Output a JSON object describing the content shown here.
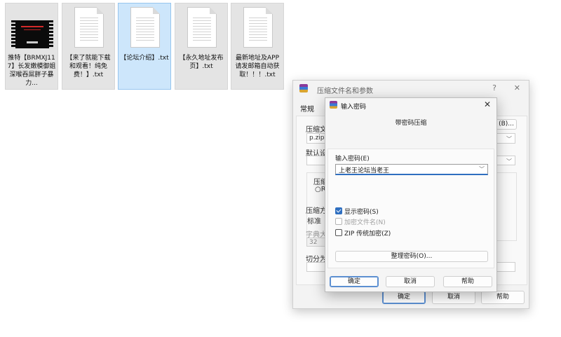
{
  "desktop": {
    "files": [
      {
        "name": "推特【BRMXJ117】长发嫩模御姐深喉吞屌胖子暴力..."
      },
      {
        "name": "【来了就能下载和观看！纯免费！】.txt"
      },
      {
        "name": "【论坛介绍】.txt"
      },
      {
        "name": "【永久地址发布页】.txt"
      },
      {
        "name": "最新地址及APP请发邮箱自动获取！！！.txt"
      }
    ]
  },
  "back_window": {
    "title": "压缩文件名和参数",
    "help_glyph": "?",
    "close_glyph": "✕",
    "tab_general": "常规",
    "archive_name_label": "压缩文",
    "archive_name_value": "p.zip",
    "browse_button": "(B)...",
    "default_profile_label": "默认设",
    "archive_format_label": "压缩",
    "radio_partial": "R",
    "compression_method_label": "压缩方",
    "compression_method_value": "标准",
    "dictionary_label": "字典大",
    "dictionary_value": "32",
    "split_label": "切分为",
    "ok_button": "确定",
    "cancel_button": "取消",
    "help_button": "帮助"
  },
  "dialog": {
    "title": "输入密码",
    "close_glyph": "✕",
    "heading": "带密码压缩",
    "password_label": "输入密码(E)",
    "password_value": "上老王论坛当老王",
    "show_password": "显示密码(S)",
    "encrypt_names": "加密文件名(N)",
    "zip_legacy": "ZIP 传统加密(Z)",
    "organize_button": "整理密码(O)...",
    "ok_button": "确定",
    "cancel_button": "取消",
    "help_button": "帮助",
    "states": {
      "show_password": true,
      "encrypt_names": false,
      "zip_legacy": false
    }
  },
  "colors": {
    "accent": "#2f6fc0",
    "selection": "#cde6fb"
  }
}
